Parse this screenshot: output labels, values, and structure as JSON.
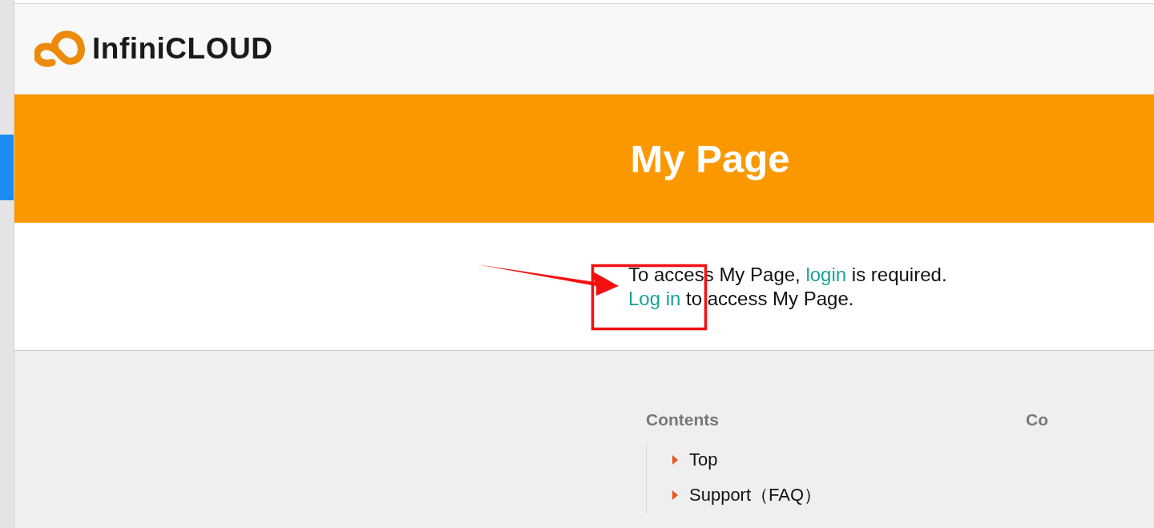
{
  "logo": {
    "text": "InfiniCLOUD"
  },
  "banner": {
    "title": "My Page"
  },
  "message": {
    "lines": [
      {
        "parts": [
          {
            "kind": "text",
            "text": "To access My Page, "
          },
          {
            "kind": "link",
            "text": "login"
          },
          {
            "kind": "text",
            "text": " is required."
          }
        ]
      },
      {
        "parts": [
          {
            "kind": "link",
            "text": "Log in"
          },
          {
            "kind": "text",
            "text": " to access My Page."
          }
        ]
      }
    ]
  },
  "footer": {
    "columns": [
      {
        "heading": "Contents",
        "items": [
          "Top",
          "Support（FAQ）"
        ]
      },
      {
        "heading": "Co"
      }
    ]
  }
}
